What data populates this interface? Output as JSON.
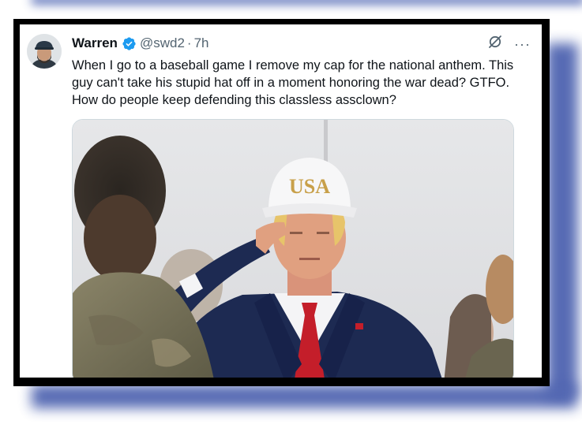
{
  "tweet": {
    "author_name": "Warren",
    "handle": "@swd2",
    "separator": "·",
    "time": "7h",
    "text_lines": [
      "When I go to a baseball game I remove my cap for the national anthem. This",
      "guy can't take his stupid hat off in a moment honoring the war dead? GTFO.",
      "How do people keep defending this classless assclown?"
    ],
    "more_label": "···"
  },
  "media": {
    "cap_text": "USA"
  },
  "icons": {
    "verified": "verified-badge-icon",
    "grok": "grok-icon",
    "more": "more-options-icon"
  },
  "colors": {
    "verified_blue": "#1d9bf0",
    "frame_black": "#000000",
    "glow_blue": "#4e63b0",
    "name_text": "#0f1419",
    "secondary_text": "#536471"
  }
}
